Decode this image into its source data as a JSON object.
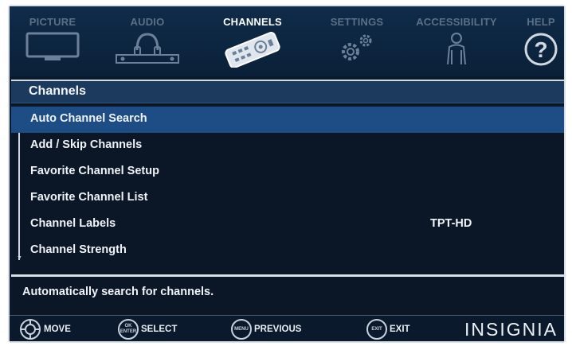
{
  "tabs": [
    {
      "label": "PICTURE",
      "icon": "tv-icon",
      "active": false
    },
    {
      "label": "AUDIO",
      "icon": "headphones-icon",
      "active": false
    },
    {
      "label": "CHANNELS",
      "icon": "remote-icon",
      "active": true
    },
    {
      "label": "SETTINGS",
      "icon": "gears-icon",
      "active": false
    },
    {
      "label": "ACCESSIBILITY",
      "icon": "person-icon",
      "active": false
    },
    {
      "label": "HELP",
      "icon": "question-icon",
      "active": false
    }
  ],
  "panel": {
    "title": "Channels",
    "items": [
      {
        "label": "Auto Channel Search",
        "value": "",
        "selected": true
      },
      {
        "label": "Add / Skip Channels",
        "value": ""
      },
      {
        "label": "Favorite Channel Setup",
        "value": ""
      },
      {
        "label": "Favorite Channel List",
        "value": ""
      },
      {
        "label": "Channel Labels",
        "value": "TPT-HD"
      },
      {
        "label": "Channel Strength",
        "value": ""
      }
    ],
    "description": "Automatically search for channels."
  },
  "bottom": {
    "move": "MOVE",
    "select_key_top": "OK",
    "select_key_bottom": "ENTER",
    "select": "SELECT",
    "menu_key": "MENU",
    "previous": "PREVIOUS",
    "exit_key": "EXIT",
    "exit": "EXIT",
    "brand": "INSIGNIA"
  },
  "colors": {
    "background": "#0a1a2c",
    "selected_row": "#1e4d86",
    "title_bar": "#1c3a5e",
    "inactive_tab": "#5b6f86"
  }
}
